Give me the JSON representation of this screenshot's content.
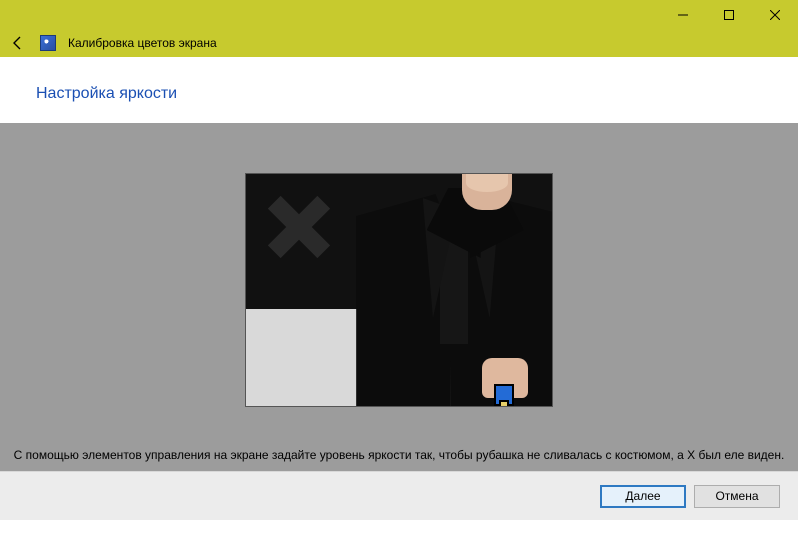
{
  "window": {
    "app_title": "Калибровка цветов экрана"
  },
  "page": {
    "title": "Настройка яркости",
    "instruction": "С помощью элементов управления на экране задайте уровень яркости так, чтобы рубашка не сливалась с костюмом, а X был еле виден."
  },
  "footer": {
    "next_label": "Далее",
    "cancel_label": "Отмена"
  }
}
